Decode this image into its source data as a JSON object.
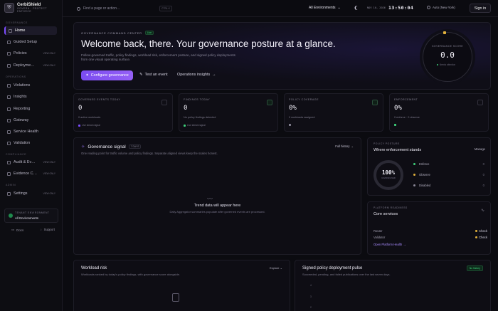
{
  "brand": {
    "name": "CerbiShield",
    "sub1": "GOVERN · PROTECT",
    "sub2": "ENFORCE",
    "logo": "shield-icon"
  },
  "sidebar": {
    "sections": {
      "governance": "GOVERNANCE",
      "operations": "OPERATIONS",
      "compliance": "COMPLIANCE",
      "admin": "ADMIN"
    },
    "items": [
      {
        "label": "Home",
        "badge": ""
      },
      {
        "label": "Guided Setup",
        "badge": ""
      },
      {
        "label": "Policies",
        "badge": "VIEW ONLY"
      },
      {
        "label": "Deployme…",
        "badge": "VIEW ONLY"
      },
      {
        "label": "Violations",
        "badge": ""
      },
      {
        "label": "Insights",
        "badge": ""
      },
      {
        "label": "Reporting",
        "badge": ""
      },
      {
        "label": "Gateway",
        "badge": ""
      },
      {
        "label": "Service Health",
        "badge": ""
      },
      {
        "label": "Validation",
        "badge": ""
      },
      {
        "label": "Audit & Ev…",
        "badge": "VIEW ONLY"
      },
      {
        "label": "Evidence C…",
        "badge": "VIEW ONLY"
      },
      {
        "label": "Settings",
        "badge": "VIEW ONLY"
      }
    ],
    "tenant": {
      "label": "TENANT ENVIRONMENT",
      "value": "All Environments"
    },
    "footer": {
      "docs": "Docs",
      "support": "Support"
    }
  },
  "topbar": {
    "search_placeholder": "Find a page or action...",
    "shortcut": "CTRL K",
    "environment": "All Environments",
    "date": "NOV 10, 2026",
    "time": "13:50:04",
    "timezone": "Auto (New York)",
    "signin": "Sign in"
  },
  "hero": {
    "eyebrow": "GOVERNANCE COMMAND CENTER",
    "live": "Live",
    "title": "Welcome back, there. Your governance posture at a glance.",
    "desc": "Follow governed traffic, policy findings, workload risk, enforcement posture, and signed policy deployments from one visual operating surface.",
    "btn_configure": "Configure governance",
    "btn_test": "Test an event",
    "btn_insights": "Operations insights",
    "score_label": "GOVERNANCE SCORE",
    "score_value": "0.0",
    "score_sub": "Needs attention"
  },
  "stats": [
    {
      "label": "GOVERNED EVENTS TODAY",
      "value": "0",
      "sub": "0 active workloads",
      "tag": "Live stream signal",
      "tag_color": "#7c4dff"
    },
    {
      "label": "FINDINGS TODAY",
      "value": "0",
      "sub": "No policy findings detected",
      "tag": "Live stream signal",
      "tag_color": "#3ecf7a"
    },
    {
      "label": "POLICY COVERAGE",
      "value": "0%",
      "sub": "0 workloads assigned",
      "tag": "",
      "tag_color": "#8a8797"
    },
    {
      "label": "ENFORCEMENT",
      "value": "0%",
      "sub": "0 enforce · 0 observe",
      "tag": "",
      "tag_color": "#3ecf7a"
    }
  ],
  "signal": {
    "title": "Governance signal",
    "badge": "7 DAYS",
    "desc": "One reading point for traffic volume and policy findings. Separate aligned views keep the scales honest.",
    "history": "Full history",
    "empty_title": "Trend data will appear here",
    "empty_sub": "Daily Aggregator summaries populate after governed events are processed."
  },
  "posture": {
    "eyebrow": "POLICY POSTURE",
    "title": "Where enforcement stands",
    "manage": "Manage",
    "ring_value": "100%",
    "ring_sub": "UNASSIGNED",
    "legend": [
      {
        "label": "Enforce",
        "value": "0",
        "color": "#3ecf7a"
      },
      {
        "label": "Observe",
        "value": "0",
        "color": "#e2b13c"
      },
      {
        "label": "Disabled",
        "value": "0",
        "color": "#8a8797"
      }
    ]
  },
  "core": {
    "eyebrow": "PLATFORM READINESS",
    "title": "Core services",
    "rows": [
      {
        "name": "Router",
        "status": "Check"
      },
      {
        "name": "Validator",
        "status": "Check"
      }
    ],
    "link": "Open Platform Health"
  },
  "workload": {
    "title": "Workload risk",
    "desc": "Workloads ranked by today's policy findings, with governance score alongside.",
    "explore": "Explore"
  },
  "pulse": {
    "title": "Signed policy deployment pulse",
    "desc": "Succeeded, pending, and failed publications over the last seven days.",
    "tag": "No history",
    "axis": [
      "4",
      "3",
      "2"
    ]
  }
}
